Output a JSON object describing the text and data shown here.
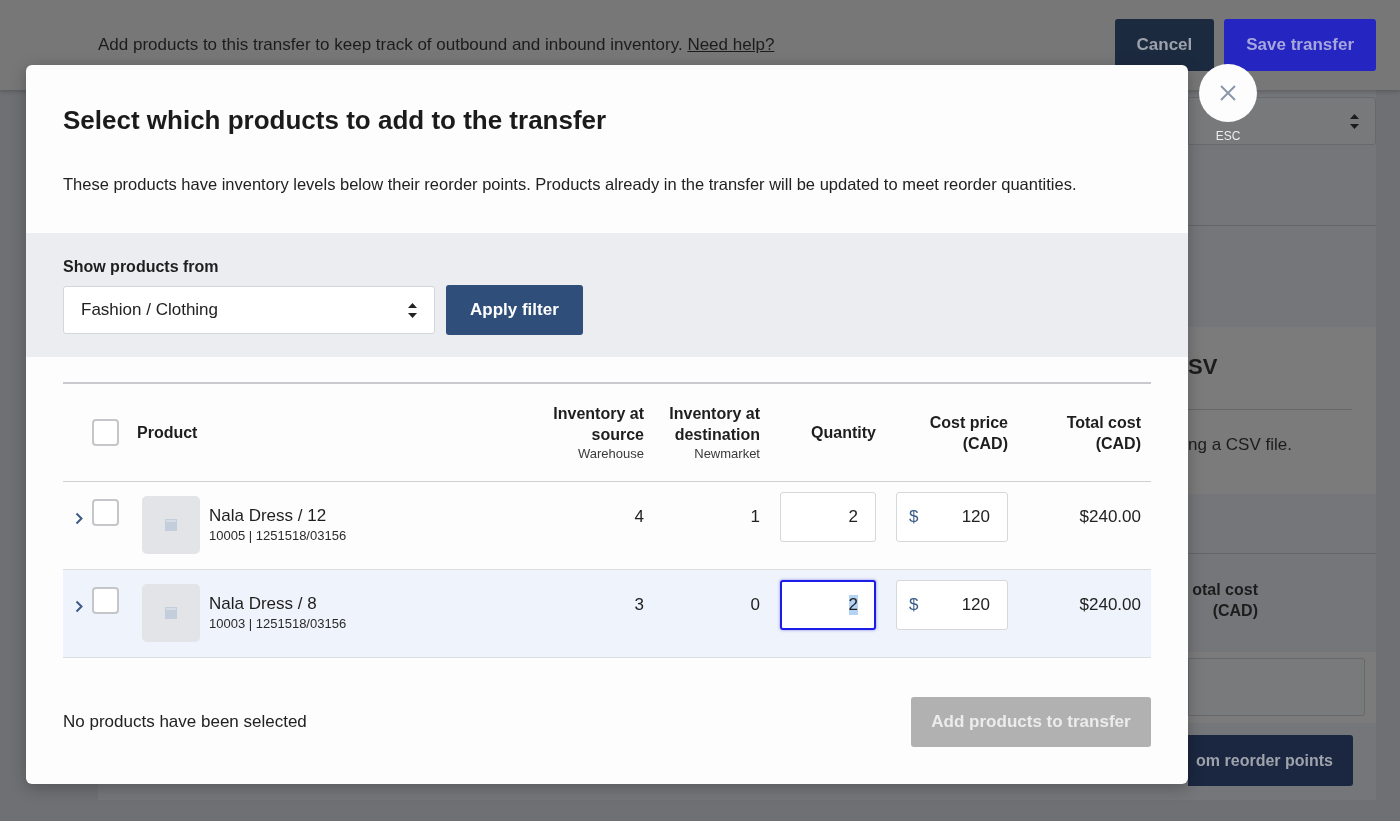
{
  "background": {
    "intro": "Add products to this transfer to keep track of outbound and inbound inventory.",
    "help_link": "Need help?",
    "buttons": [
      {
        "label": "Cancel",
        "kind": "secondary"
      },
      {
        "label": "Save transfer",
        "kind": "primary"
      }
    ],
    "card": {
      "title": "SV",
      "text": "ng a CSV file."
    },
    "column_header": "otal cost (CAD)",
    "button": "om reorder points"
  },
  "modal": {
    "title": "Select which products to add to the transfer",
    "description": "These products have inventory levels below their reorder points. Products already in the transfer will be updated to meet reorder quantities.",
    "close_hint": "ESC",
    "filter": {
      "label": "Show products from",
      "value": "Fashion / Clothing",
      "button": "Apply filter"
    },
    "table": {
      "select_all": {
        "checked": false
      },
      "columns": [
        {
          "label": "Product"
        },
        {
          "label": "Inventory at source",
          "sublabel": "Warehouse"
        },
        {
          "label": "Inventory at destination",
          "sublabel": "Newmarket"
        },
        {
          "label": "Quantity"
        },
        {
          "label": "Cost price (CAD)"
        },
        {
          "label": "Total cost (CAD)"
        }
      ],
      "rows": [
        {
          "name": "Nala Dress / 12",
          "details": "10005 | 1251518/03156",
          "inventory_at_source": "4",
          "inventory_at_destination": "1",
          "quantity": "2",
          "currency_symbol": "$",
          "cost_price": "120",
          "total_cost": "$240.00",
          "checked": false,
          "expanded": false,
          "highlighted": false,
          "quantity_focused": false,
          "quantity_text_selected": false
        },
        {
          "name": "Nala Dress / 8",
          "details": "10003 | 1251518/03156",
          "inventory_at_source": "3",
          "inventory_at_destination": "0",
          "quantity": "2",
          "currency_symbol": "$",
          "cost_price": "120",
          "total_cost": "$240.00",
          "checked": false,
          "expanded": false,
          "highlighted": true,
          "quantity_focused": true,
          "quantity_text_selected": true
        }
      ]
    },
    "footer": {
      "status": "No products have been selected",
      "button": {
        "label": "Add products to transfer",
        "disabled": true
      }
    }
  }
}
